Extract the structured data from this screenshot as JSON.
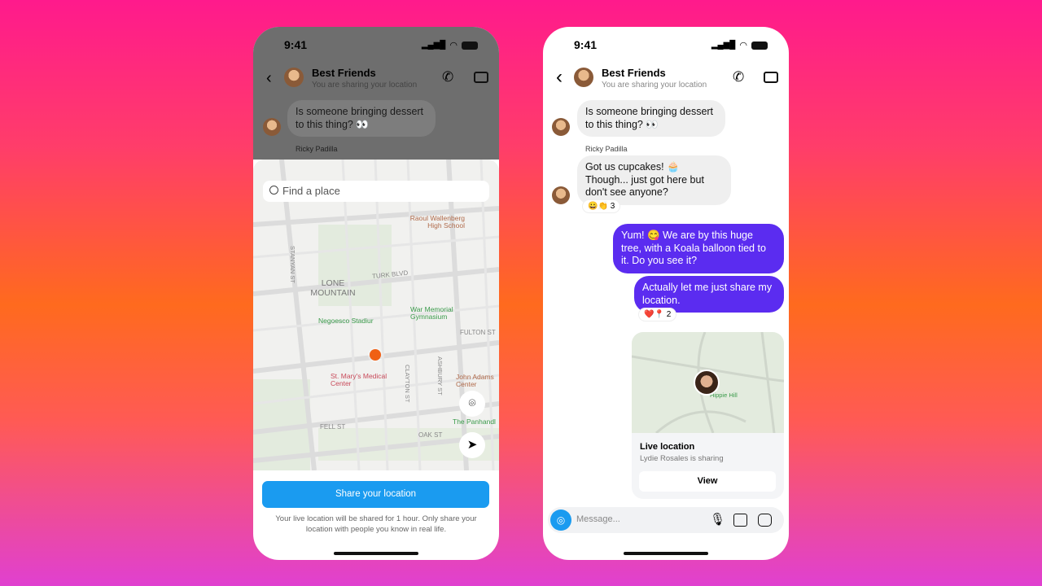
{
  "status_time": "9:41",
  "chat": {
    "title": "Best Friends",
    "subtitle": "You are sharing your location"
  },
  "messages": [
    {
      "text": "Is someone bringing dessert to this thing? 👀",
      "sender": ""
    },
    {
      "sender": "Ricky Padilla",
      "text": "Got us cupcakes! 🧁 Though... just got here but don't see anyone?",
      "reactions": "😀👏",
      "reaction_count": "3"
    },
    {
      "text": "Yum! 😋 We are by this huge tree, with a Koala balloon tied to it. Do you see it?"
    },
    {
      "text": "Actually let me just share my location.",
      "reactions": "❤️📍",
      "reaction_count": "2"
    }
  ],
  "live_location": {
    "title": "Live location",
    "subtitle": "Lydie Rosales is sharing",
    "view_label": "View",
    "map_label": "Hippie Hill"
  },
  "composer": {
    "placeholder": "Message..."
  },
  "share_sheet": {
    "search_placeholder": "Find a place",
    "map_labels": {
      "school": "Raoul Wallenberg High School",
      "area": "LONE MOUNTAIN",
      "turk": "TURK BLVD",
      "stadium": "Negoesco Stadiur",
      "gym": "War Memorial Gymnasium",
      "fulton": "FULTON ST",
      "hospital": "St. Mary's Medical Center",
      "adams": "John Adams Center",
      "fell": "FELL ST",
      "oak": "OAK ST",
      "panhandle": "The Panhandl",
      "stanyan": "STANYAN ST",
      "clayton": "CLAYTON ST",
      "ashbury": "ASHBURY ST"
    },
    "share_button": "Share your location",
    "disclaimer": "Your live location will be shared for 1 hour. Only share your location with people you know in real life."
  },
  "colors": {
    "accent_blue": "#1a9bf0",
    "my_bubble": "#5b2cf0",
    "location_pin": "#f06014"
  }
}
